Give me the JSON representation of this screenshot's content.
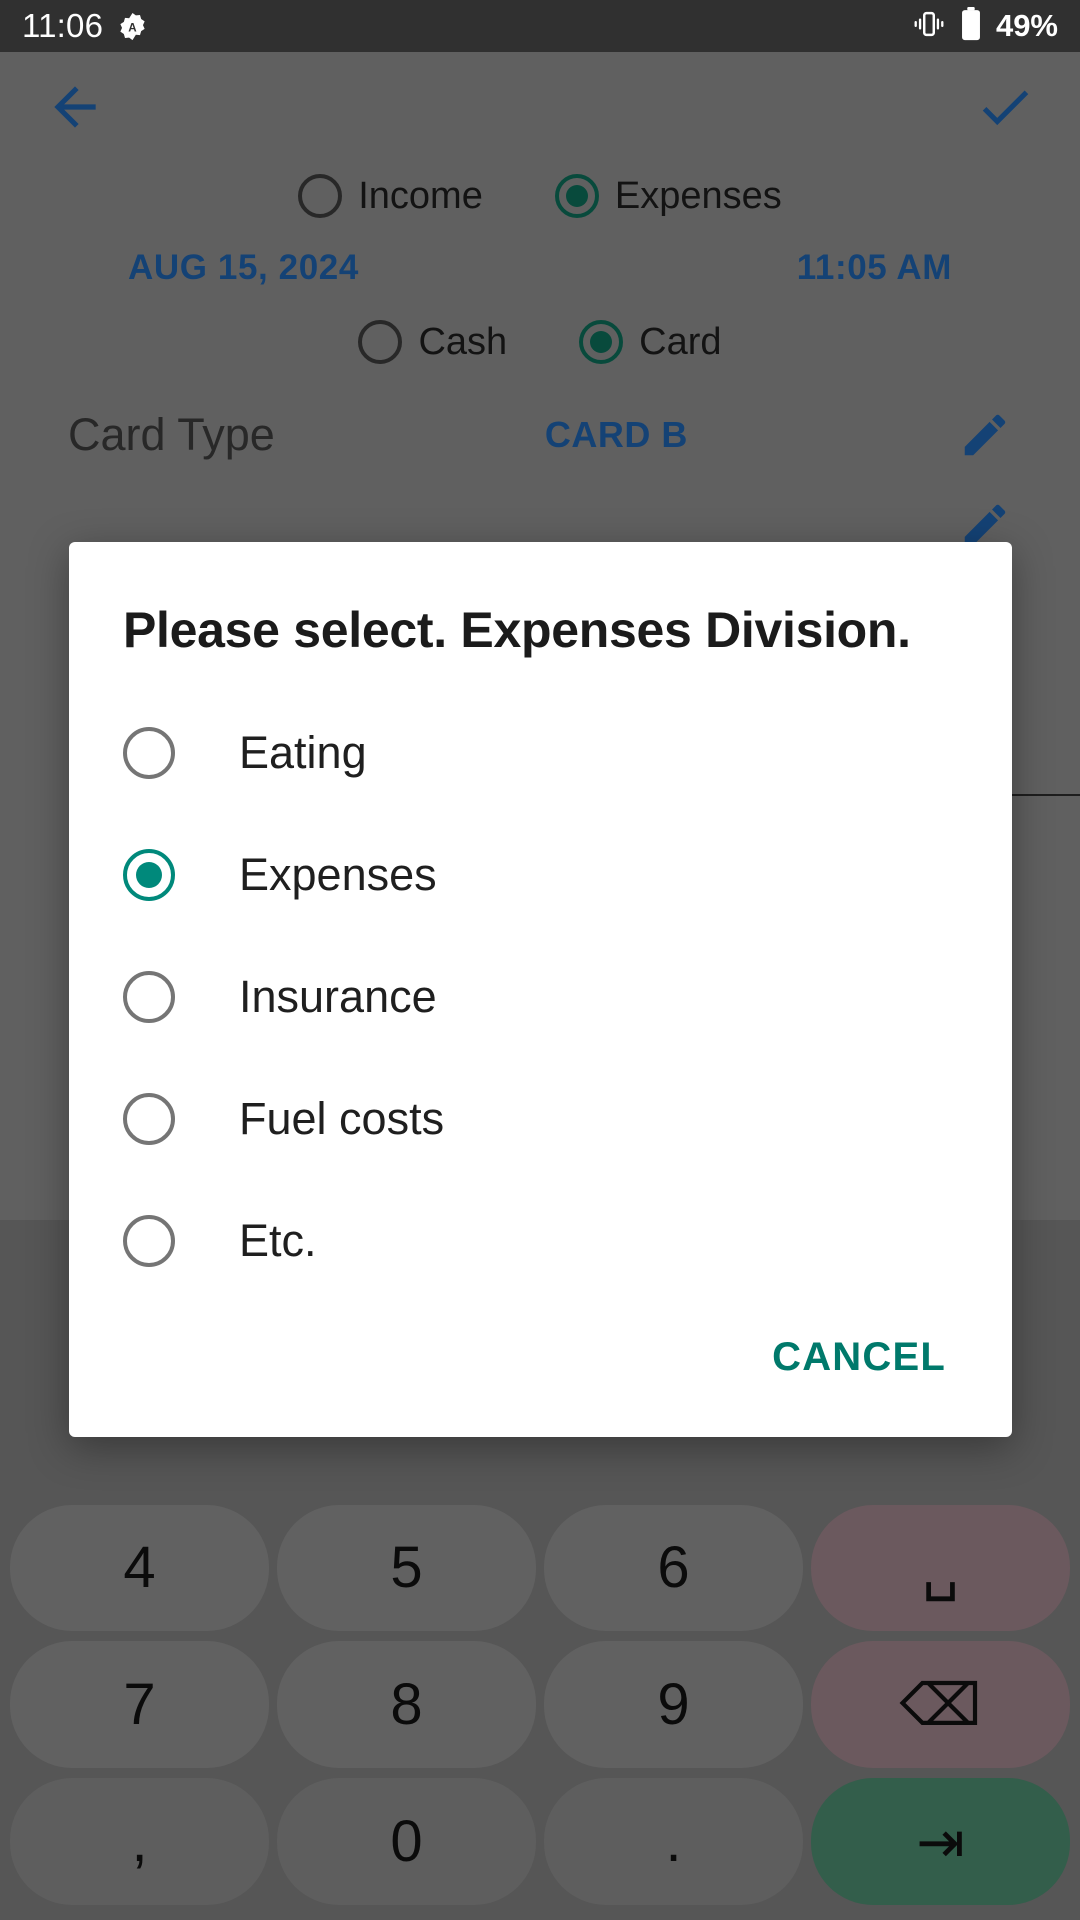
{
  "status_bar": {
    "clock": "11:06",
    "app_icon": "app-alert-icon",
    "vibrate_icon": "vibrate-icon",
    "battery_icon": "battery-icon",
    "battery_text": "49%"
  },
  "app": {
    "back_icon": "back-arrow-icon",
    "confirm_icon": "check-icon",
    "type_radios": [
      {
        "label": "Income",
        "selected": false
      },
      {
        "label": "Expenses",
        "selected": true
      }
    ],
    "date": "AUG 15, 2024",
    "time": "11:05 AM",
    "payment_radios": [
      {
        "label": "Cash",
        "selected": false
      },
      {
        "label": "Card",
        "selected": true
      }
    ],
    "card_type_label": "Card Type",
    "card_type_value": "CARD B",
    "edit_icon": "pencil-icon"
  },
  "dialog": {
    "title": "Please select. Expenses Division.",
    "options": [
      {
        "label": "Eating",
        "selected": false
      },
      {
        "label": "Expenses",
        "selected": true
      },
      {
        "label": "Insurance",
        "selected": false
      },
      {
        "label": "Fuel costs",
        "selected": false
      },
      {
        "label": "Etc.",
        "selected": false
      }
    ],
    "cancel_label": "CANCEL",
    "accent_color": "#00897b",
    "cancel_color": "#00796b"
  },
  "keyboard": {
    "rows": [
      [
        {
          "label": "4",
          "name": "key-4",
          "kind": "num"
        },
        {
          "label": "5",
          "name": "key-5",
          "kind": "num"
        },
        {
          "label": "6",
          "name": "key-6",
          "kind": "num"
        },
        {
          "label": "␣",
          "name": "space-key",
          "kind": "fn"
        }
      ],
      [
        {
          "label": "7",
          "name": "key-7",
          "kind": "num"
        },
        {
          "label": "8",
          "name": "key-8",
          "kind": "num"
        },
        {
          "label": "9",
          "name": "key-9",
          "kind": "num"
        },
        {
          "label": "⌫",
          "name": "backspace-key",
          "kind": "fn"
        }
      ],
      [
        {
          "label": ",",
          "name": "key-comma",
          "kind": "num"
        },
        {
          "label": "0",
          "name": "key-0",
          "kind": "num"
        },
        {
          "label": ".",
          "name": "key-period",
          "kind": "num"
        },
        {
          "label": "⇥",
          "name": "enter-next-key",
          "kind": "enter"
        }
      ]
    ]
  }
}
